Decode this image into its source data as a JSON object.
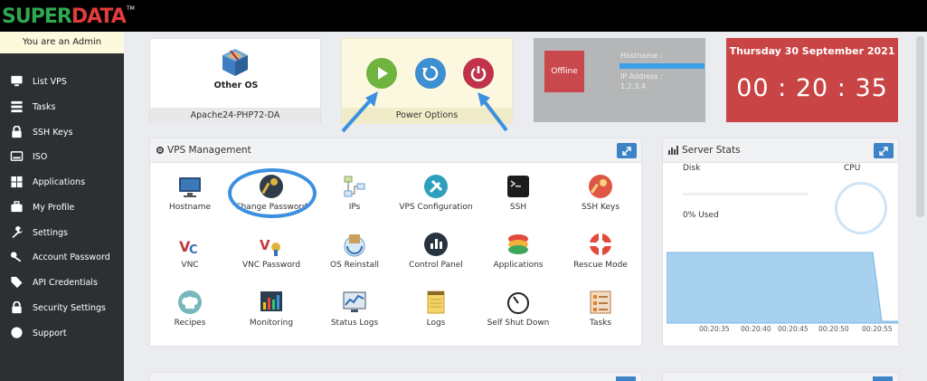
{
  "logo": {
    "part1": "SUPER",
    "part2": "DATA",
    "tm": "TM"
  },
  "sidebar": {
    "admin_text": "You are an Admin",
    "items": [
      {
        "label": "List VPS",
        "icon": "monitor-icon"
      },
      {
        "label": "Tasks",
        "icon": "tasks-icon"
      },
      {
        "label": "SSH Keys",
        "icon": "lock-icon"
      },
      {
        "label": "ISO",
        "icon": "disk-icon"
      },
      {
        "label": "Applications",
        "icon": "applications-icon"
      },
      {
        "label": "My Profile",
        "icon": "briefcase-icon"
      },
      {
        "label": "Settings",
        "icon": "wrench-icon"
      },
      {
        "label": "Account Password",
        "icon": "key-icon"
      },
      {
        "label": "API Credentials",
        "icon": "tag-icon"
      },
      {
        "label": "Security Settings",
        "icon": "lock-icon"
      },
      {
        "label": "Support",
        "icon": "question-icon"
      }
    ]
  },
  "os_card": {
    "name": "Other OS",
    "package": "Apache24-PHP72-DA"
  },
  "power_card": {
    "label": "Power Options"
  },
  "status_card": {
    "status": "Offline",
    "hostname_label": "Hostname :",
    "ip_label": "IP Address :",
    "ip_value": "1.2.3.4"
  },
  "clock_card": {
    "date": "Thursday 30 September 2021",
    "time": "00 : 20 : 35"
  },
  "vps_panel": {
    "title": "VPS Management",
    "tiles": [
      {
        "label": "Hostname",
        "icon": "monitor-icon"
      },
      {
        "label": "Change Password",
        "icon": "key-icon"
      },
      {
        "label": "IPs",
        "icon": "network-icon"
      },
      {
        "label": "VPS Configuration",
        "icon": "tools-icon"
      },
      {
        "label": "SSH",
        "icon": "terminal-icon"
      },
      {
        "label": "SSH Keys",
        "icon": "ssh-key-icon"
      },
      {
        "label": "VNC",
        "icon": "vnc-icon"
      },
      {
        "label": "VNC Password",
        "icon": "vnc-password-icon"
      },
      {
        "label": "OS Reinstall",
        "icon": "os-reinstall-icon"
      },
      {
        "label": "Control Panel",
        "icon": "control-panel-icon"
      },
      {
        "label": "Applications",
        "icon": "applications-icon"
      },
      {
        "label": "Rescue Mode",
        "icon": "lifebuoy-icon"
      },
      {
        "label": "Recipes",
        "icon": "chef-hat-icon"
      },
      {
        "label": "Monitoring",
        "icon": "bar-chart-icon"
      },
      {
        "label": "Status Logs",
        "icon": "line-chart-icon"
      },
      {
        "label": "Logs",
        "icon": "notepad-icon"
      },
      {
        "label": "Self Shut Down",
        "icon": "timer-icon"
      },
      {
        "label": "Tasks",
        "icon": "task-list-icon"
      }
    ]
  },
  "stats_panel": {
    "title": "Server Stats",
    "disk_label": "Disk",
    "disk_used": "0% Used",
    "cpu_label": "CPU",
    "time_ticks": [
      "00:20:35",
      "00:20:40",
      "00:20:45",
      "00:20:50",
      "00:20:55"
    ]
  },
  "colors": {
    "accent": "#3d83c7",
    "clock": "#c94444",
    "offline": "#c9484b",
    "play": "#6fb43f",
    "power": "#c0334b"
  }
}
